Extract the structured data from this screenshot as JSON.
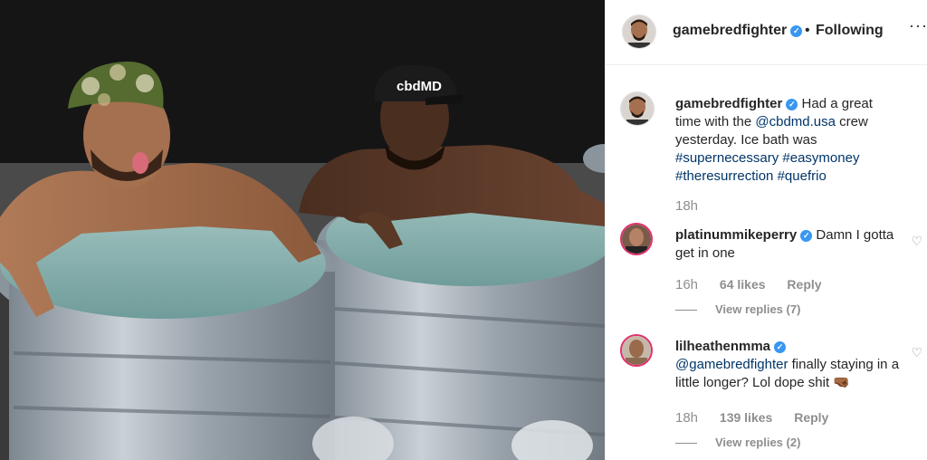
{
  "post": {
    "username": "gamebredfighter",
    "follow_status": "Following",
    "dot": "•",
    "more": "···"
  },
  "caption": {
    "username": "gamebredfighter",
    "text_1": "Had a great time with the ",
    "mention": "@cbdmd.usa",
    "text_2": " crew yesterday. Ice bath was ",
    "hashtags": [
      "#supernecessary",
      "#easymoney",
      "#theresurrection",
      "#quefrio"
    ],
    "time": "18h"
  },
  "comments": [
    {
      "username": "platinummikeperry",
      "text": "Damn I gotta get in one",
      "time": "16h",
      "likes": "64 likes",
      "reply": "Reply",
      "view_replies": "View replies (7)"
    },
    {
      "username": "lilheathenmma",
      "mention": "@gamebredfighter",
      "text": " finally staying in a little longer? Lol dope shit 🤜🏾",
      "time": "18h",
      "likes": "139 likes",
      "reply": "Reply",
      "view_replies": "View replies (2)"
    }
  ],
  "photo": {
    "cap_text": "cbdMD"
  },
  "icons": {
    "verified": "verified-check-icon",
    "heart": "heart-outline-icon"
  },
  "colors": {
    "link": "#003569",
    "verified": "#3897f0",
    "muted": "#8e8e8e"
  }
}
